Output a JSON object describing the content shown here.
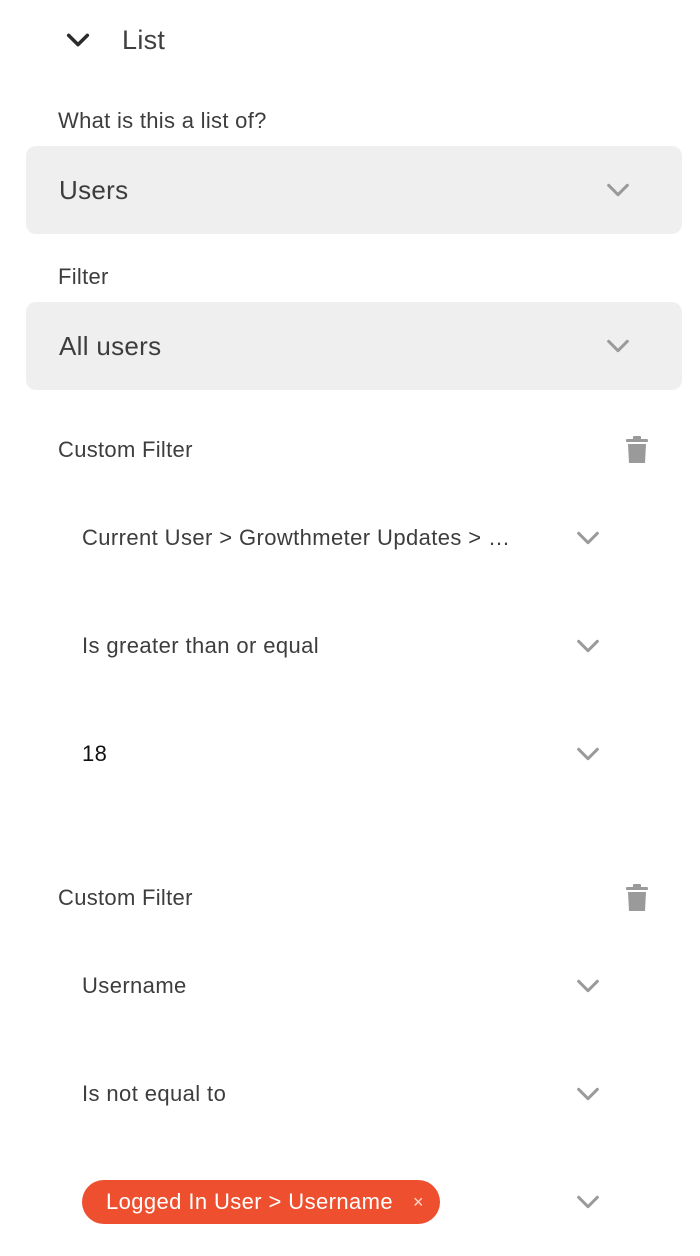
{
  "section": {
    "title": "List"
  },
  "list_of": {
    "label": "What is this a list of?",
    "value": "Users"
  },
  "filter": {
    "label": "Filter",
    "value": "All users"
  },
  "custom_filters": [
    {
      "title": "Custom Filter",
      "field": "Current User > Growthmeter Updates > …",
      "operator": "Is greater than or equal",
      "value": "18"
    },
    {
      "title": "Custom Filter",
      "field": "Username",
      "operator": "Is not equal to",
      "value_tag": "Logged In User > Username",
      "tag_close": "×"
    }
  ],
  "colors": {
    "tag": "#ee4f2e",
    "select_bg": "#efefef",
    "icon": "#8e8e8e"
  },
  "icons": [
    "chevron-down-icon",
    "trash-icon",
    "close-icon"
  ]
}
